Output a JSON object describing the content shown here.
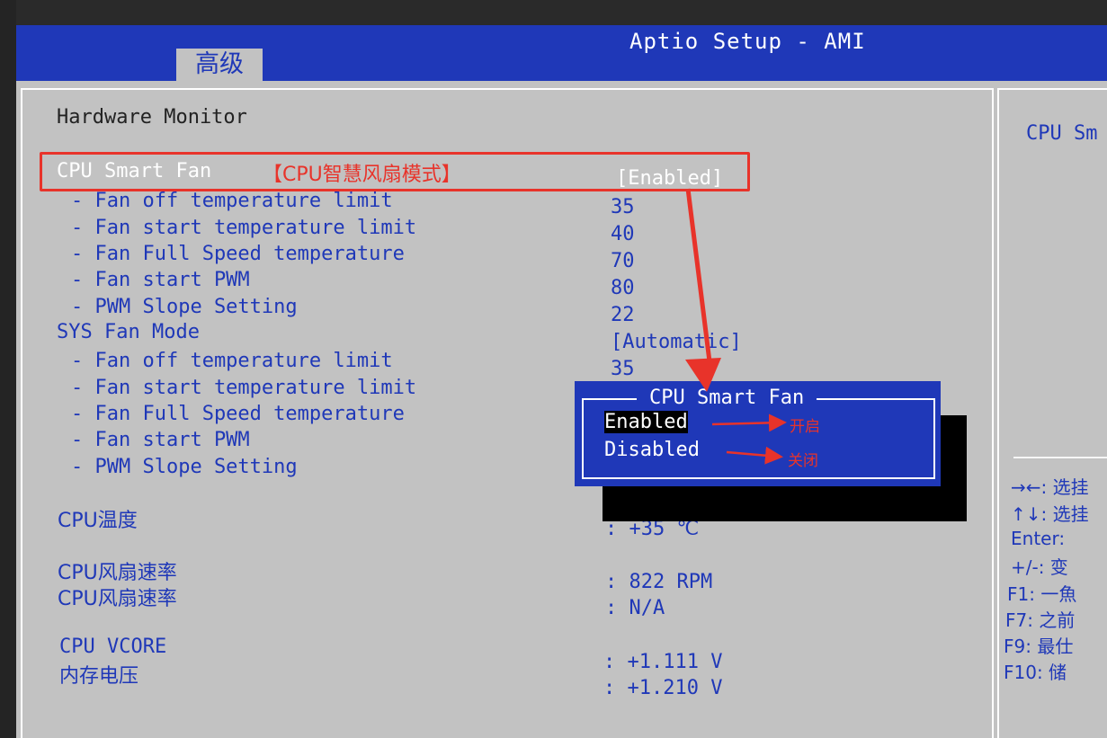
{
  "header": {
    "title": "Aptio Setup - AMI",
    "active_tab": "高级"
  },
  "section_title": "Hardware Monitor",
  "settings": [
    {
      "label": "CPU Smart Fan",
      "value": "[Enabled]"
    },
    {
      "label": "- Fan off temperature limit",
      "value": "35"
    },
    {
      "label": "- Fan start temperature limit",
      "value": "40"
    },
    {
      "label": "- Fan Full Speed temperature",
      "value": "70"
    },
    {
      "label": "- Fan start PWM",
      "value": "80"
    },
    {
      "label": "- PWM Slope Setting",
      "value": "22"
    },
    {
      "label": "SYS Fan Mode",
      "value": "[Automatic]"
    },
    {
      "label": "- Fan off temperature limit",
      "value": "35"
    },
    {
      "label": "- Fan start temperature limit",
      "value": ""
    },
    {
      "label": "- Fan Full Speed temperature",
      "value": ""
    },
    {
      "label": "- Fan start PWM",
      "value": ""
    },
    {
      "label": "- PWM Slope Setting",
      "value": ""
    }
  ],
  "readings": [
    {
      "label": "CPU温度",
      "value": ": +35 ℃"
    },
    {
      "label": "CPU风扇速率",
      "value": ": 822 RPM"
    },
    {
      "label": "CPU风扇速率",
      "value": ": N/A"
    },
    {
      "label": "CPU VCORE",
      "value": ": +1.111 V"
    },
    {
      "label": "内存电压",
      "value": ": +1.210 V"
    }
  ],
  "annotation": {
    "highlight_label": "【CPU智慧风扇模式】",
    "enabled_note": "开启",
    "disabled_note": "关闭"
  },
  "popup": {
    "title": "CPU Smart Fan",
    "options": [
      "Enabled",
      "Disabled"
    ],
    "selected": "Enabled"
  },
  "help": {
    "description": "CPU Sm",
    "keys": [
      "→←: 选挂",
      "↑↓: 选挂",
      "Enter:",
      "+/-: 变",
      "F1: 一魚",
      "F7: 之前",
      "F9: 最仕",
      "F10: 储"
    ]
  },
  "colors": {
    "bios_blue": "#1f38b8",
    "panel_gray": "#c2c2c2",
    "highlight_red": "#e8332a"
  }
}
